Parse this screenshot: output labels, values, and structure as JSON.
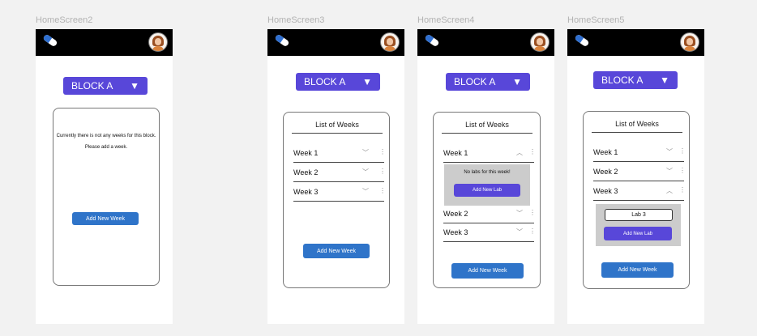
{
  "screens": [
    {
      "label": "HomeScreen2",
      "block_label": "BLOCK A",
      "empty_line1": "Currently there is not any weeks for this block.",
      "empty_line2": "Please add a week.",
      "add_week_label": "Add New Week"
    },
    {
      "label": "HomeScreen3",
      "block_label": "BLOCK A",
      "list_title": "List of Weeks",
      "weeks": [
        "Week 1",
        "Week 2",
        "Week 3"
      ],
      "add_week_label": "Add New Week"
    },
    {
      "label": "HomeScreen4",
      "block_label": "BLOCK A",
      "list_title": "List of Weeks",
      "weeks": [
        "Week 1",
        "Week 2",
        "Week 3"
      ],
      "no_labs_text": "No labs for this week!",
      "add_lab_label": "Add New Lab",
      "add_week_label": "Add New Week"
    },
    {
      "label": "HomeScreen5",
      "block_label": "BLOCK A",
      "list_title": "List of Weeks",
      "weeks": [
        "Week 1",
        "Week 2",
        "Week 3"
      ],
      "lab_name": "Lab 3",
      "add_lab_label": "Add New Lab",
      "add_week_label": "Add New Week"
    }
  ],
  "icons": {
    "arrow": "▼",
    "chevron_down": "﹀",
    "chevron_up": "︿",
    "more": "⋮",
    "logo": "pill-icon",
    "avatar": "avatar-icon"
  },
  "colors": {
    "topbar": "#000000",
    "accent_purple": "#5847d9",
    "button_blue": "#2f74c9",
    "panel_gray": "#cccccc",
    "canvas": "#f2f2f2"
  }
}
